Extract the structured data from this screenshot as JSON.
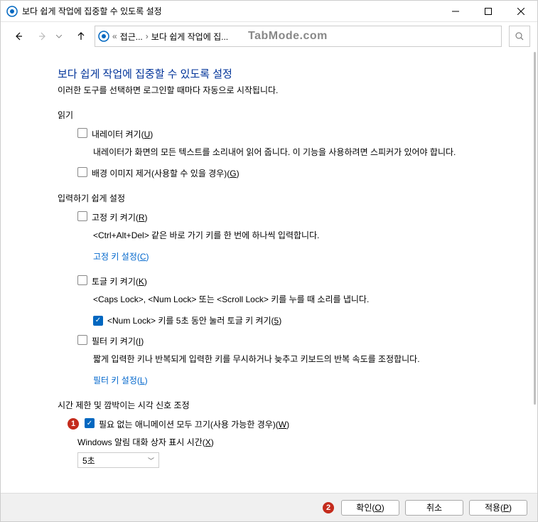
{
  "titlebar": {
    "title": "보다 쉽게 작업에 집중할 수 있도록 설정"
  },
  "breadcrumb": {
    "item1": "접근...",
    "item2": "보다 쉽게 작업에 집...",
    "watermark": "TabMode.com"
  },
  "page": {
    "title": "보다 쉽게 작업에 집중할 수 있도록 설정",
    "subtitle": "이러한 도구를 선택하면 로그인할 때마다 자동으로 시작됩니다."
  },
  "section1": {
    "header": "읽기",
    "opt1_label": "내레이터 켜기(",
    "opt1_key": "U",
    "opt1_close": ")",
    "opt1_desc": "내레이터가 화면의 모든 텍스트를 소리내어 읽어 줍니다. 이 기능을 사용하려면 스피커가 있어야 합니다.",
    "opt2_label": "배경 이미지 제거(사용할 수 있을 경우)(",
    "opt2_key": "G",
    "opt2_close": ")"
  },
  "section2": {
    "header": "입력하기 쉽게 설정",
    "opt1_label": "고정 키 켜기(",
    "opt1_key": "R",
    "opt1_close": ")",
    "opt1_desc": "<Ctrl+Alt+Del> 같은 바로 가기 키를 한 번에 하나씩 입력합니다.",
    "opt1_link": "고정 키 설정(",
    "opt1_link_key": "C",
    "opt1_link_close": ")",
    "opt2_label": "토글 키 켜기(",
    "opt2_key": "K",
    "opt2_close": ")",
    "opt2_desc": "<Caps Lock>, <Num Lock> 또는 <Scroll Lock> 키를 누를 때 소리를 냅니다.",
    "opt2_sub": "<Num Lock> 키를 5초 동안 눌러 토글 키 켜기(",
    "opt2_sub_key": "5",
    "opt2_sub_close": ")",
    "opt3_label": "필터 키 켜기(",
    "opt3_key": "I",
    "opt3_close": ")",
    "opt3_desc": "짧게 입력한 키나 반복되게 입력한 키를 무시하거나 늦추고 키보드의 반복 속도를 조정합니다.",
    "opt3_link": "필터 키 설정(",
    "opt3_link_key": "L",
    "opt3_link_close": ")"
  },
  "section3": {
    "header": "시간 제한 및 깜박이는 시각 신호 조정",
    "opt1_label": "필요 없는 애니메이션 모두 끄기(사용 가능한 경우)(",
    "opt1_key": "W",
    "opt1_close": ")",
    "dropdown_label": "Windows 알림 대화 상자 표시 시간(",
    "dropdown_key": "X",
    "dropdown_close": ")",
    "dropdown_value": "5초"
  },
  "badges": {
    "b1": "1",
    "b2": "2"
  },
  "buttons": {
    "ok": "확인(",
    "ok_key": "O",
    "ok_close": ")",
    "cancel": "취소",
    "apply": "적용(",
    "apply_key": "P",
    "apply_close": ")"
  }
}
